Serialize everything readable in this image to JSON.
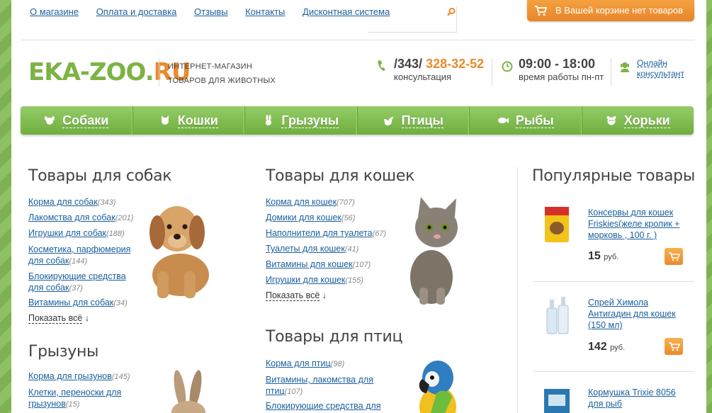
{
  "topnav": [
    "О магазине",
    "Оплата и доставка",
    "Отзывы",
    "Контакты",
    "Дисконтная система"
  ],
  "cart": {
    "label": "В Вашей корзине нет товаров"
  },
  "logo": {
    "green": "EKA-ZOO.",
    "orange": "RU"
  },
  "tagline": {
    "line1": "ИНТЕРНЕТ-МАГАЗИН",
    "line2": "ТОВАРОВ ДЛЯ ЖИВОТНЫХ"
  },
  "phone": {
    "code": "/343/",
    "number": "328-32-52",
    "sub": "консультация"
  },
  "hours": {
    "time": "09:00 - 18:00",
    "sub": "время работы пн-пт"
  },
  "consultant": {
    "label": "Онлайн консультант"
  },
  "categories": [
    "Собаки",
    "Кошки",
    "Грызуны",
    "Птицы",
    "Рыбы",
    "Хорьки"
  ],
  "dogs": {
    "title": "Товары для собак",
    "items": [
      {
        "name": "Корма для собак",
        "count": "(343)"
      },
      {
        "name": "Лакомства для собак",
        "count": "(201)"
      },
      {
        "name": "Игрушки для собак",
        "count": "(188)"
      },
      {
        "name": "Косметика, парфюмерия для собак",
        "count": "(144)"
      },
      {
        "name": "Блокирующие средства для собак",
        "count": "(37)"
      },
      {
        "name": "Витамины для собак",
        "count": "(34)"
      }
    ],
    "show_all": "Показать всё"
  },
  "cats": {
    "title": "Товары для кошек",
    "items": [
      {
        "name": "Корма для кошек",
        "count": "(707)"
      },
      {
        "name": "Домики для кошек",
        "count": "(56)"
      },
      {
        "name": "Наполнители для туалета",
        "count": "(67)"
      },
      {
        "name": "Туалеты для кошек",
        "count": "(41)"
      },
      {
        "name": "Витамины для кошек",
        "count": "(107)"
      },
      {
        "name": "Игрушки для кошек",
        "count": "(155)"
      }
    ],
    "show_all": "Показать всё"
  },
  "rodents": {
    "title": "Грызуны",
    "items": [
      {
        "name": "Корма для грызунов",
        "count": "(145)"
      },
      {
        "name": "Клетки, переноски для грызунов",
        "count": "(15)"
      }
    ]
  },
  "birds": {
    "title": "Товары для птиц",
    "items": [
      {
        "name": "Корма для птиц",
        "count": "(98)"
      },
      {
        "name": "Витамины, лакомства для птиц",
        "count": "(107)"
      },
      {
        "name": "Блокирующие средства для",
        "count": ""
      }
    ]
  },
  "popular": {
    "title": "Популярные товары",
    "currency": "руб.",
    "products": [
      {
        "name": "Консервы для кошек Friskies(желе кролик + морковь , 100 г. )",
        "price": "15"
      },
      {
        "name": "Спрей Химола Антигадин для кошек (150 мл)",
        "price": "142"
      },
      {
        "name": "Кормушка Trixie 8056 для рыб",
        "price": ""
      }
    ]
  },
  "colors": {
    "green": "#7cb343",
    "orange": "#ea8a2b",
    "link": "#1a5f9e"
  }
}
